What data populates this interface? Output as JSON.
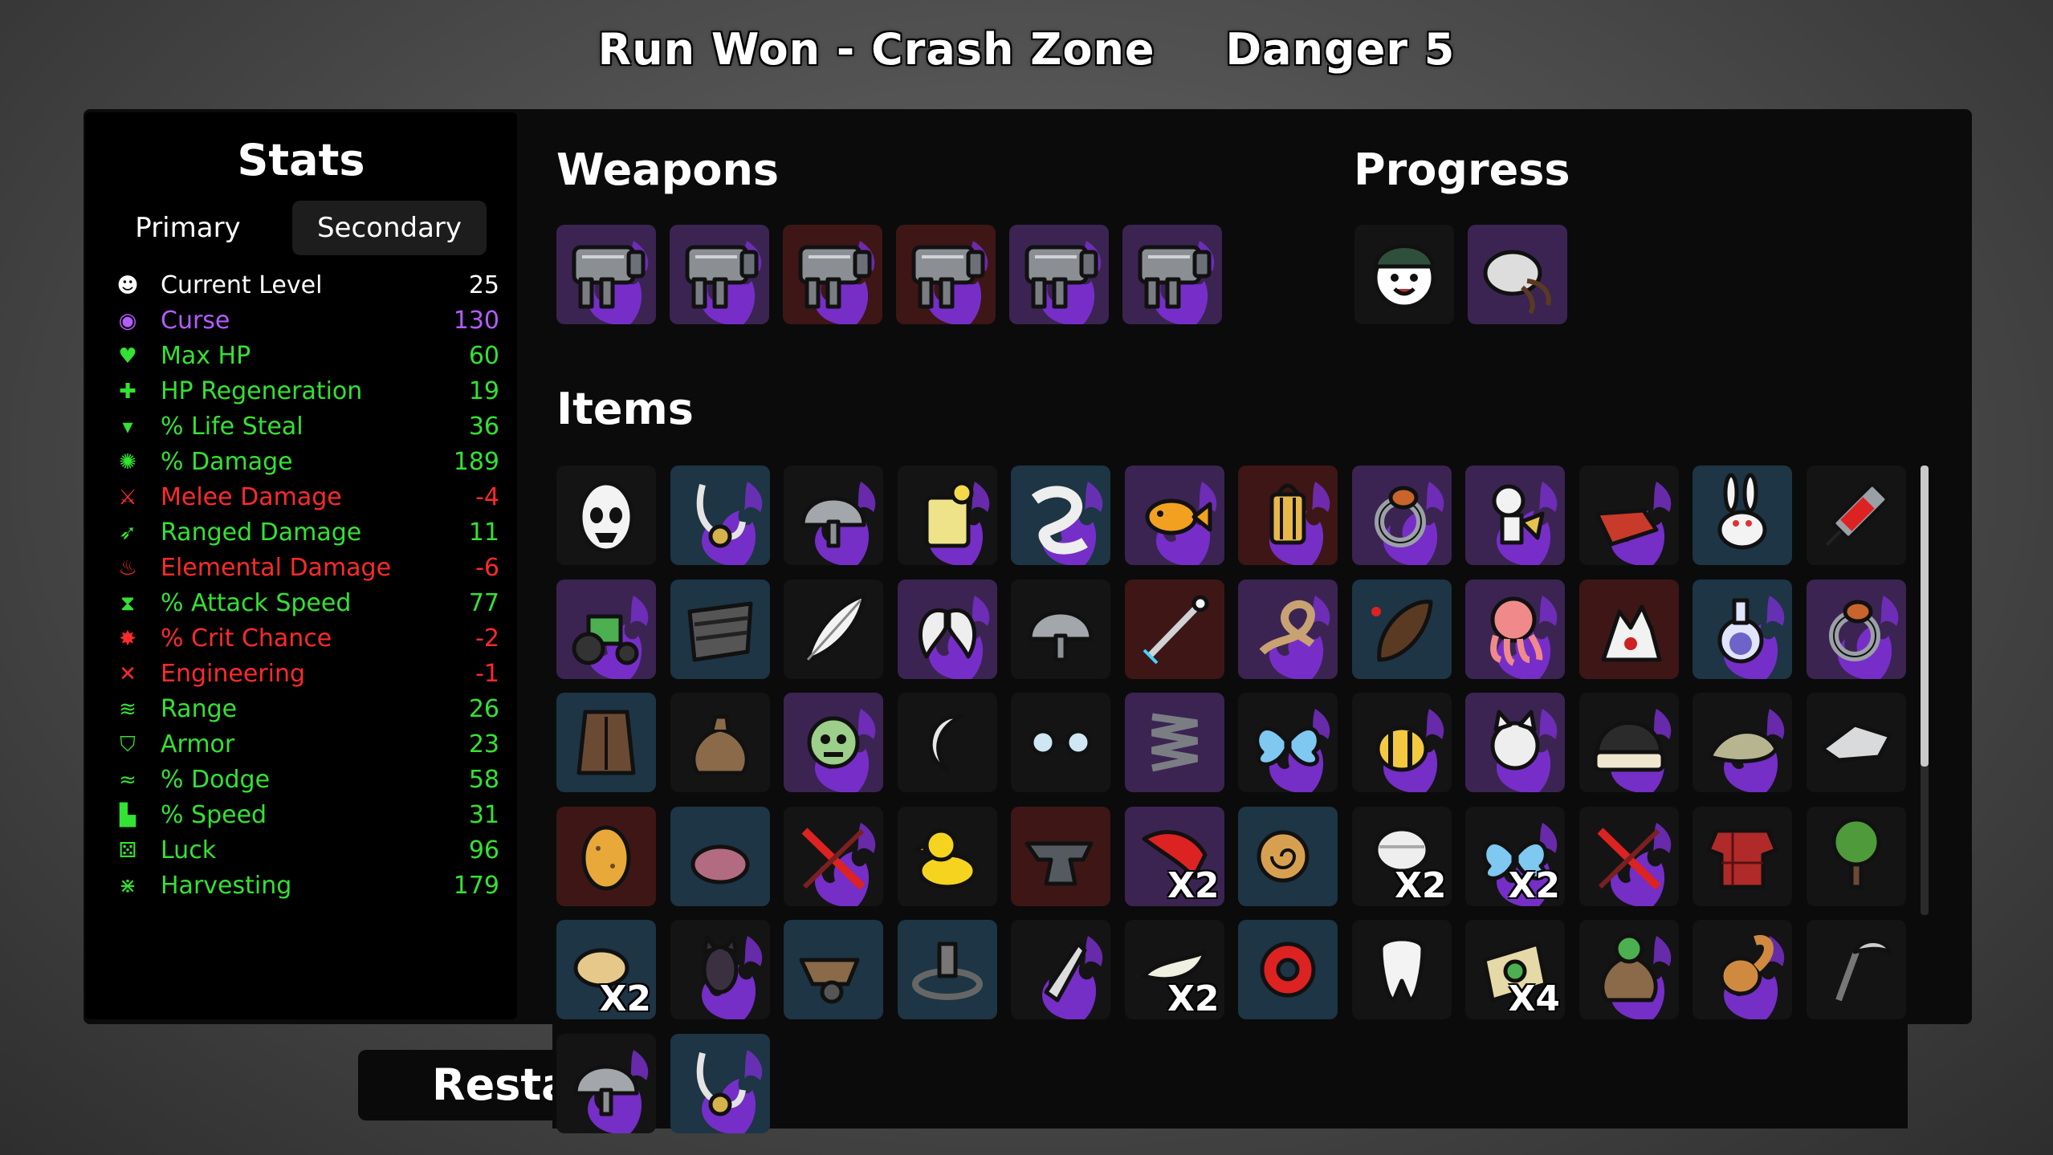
{
  "header": {
    "run": "Run Won - Crash Zone",
    "danger": "Danger 5"
  },
  "stats": {
    "title": "Stats",
    "tabs": {
      "primary": "Primary",
      "secondary": "Secondary"
    },
    "level": {
      "label": "Current Level",
      "value": "25"
    },
    "rows": [
      {
        "label": "Curse",
        "value": "130",
        "color": "#b35cff",
        "icon": "curse-eye-icon"
      },
      {
        "label": "Max HP",
        "value": "60",
        "color": "#33e233",
        "icon": "heart-icon"
      },
      {
        "label": "HP Regeneration",
        "value": "19",
        "color": "#33e233",
        "icon": "regen-heart-icon"
      },
      {
        "label": "% Life Steal",
        "value": "36",
        "color": "#33e233",
        "icon": "fangs-icon"
      },
      {
        "label": "% Damage",
        "value": "189",
        "color": "#33e233",
        "icon": "brain-icon"
      },
      {
        "label": "Melee Damage",
        "value": "-4",
        "color": "#ff2a2a",
        "icon": "sword-icon"
      },
      {
        "label": "Ranged Damage",
        "value": "11",
        "color": "#33e233",
        "icon": "bow-icon"
      },
      {
        "label": "Elemental Damage",
        "value": "-6",
        "color": "#ff2a2a",
        "icon": "flame-icon"
      },
      {
        "label": "% Attack Speed",
        "value": "77",
        "color": "#33e233",
        "icon": "hourglass-icon"
      },
      {
        "label": "% Crit Chance",
        "value": "-2",
        "color": "#ff2a2a",
        "icon": "crit-star-icon"
      },
      {
        "label": "Engineering",
        "value": "-1",
        "color": "#ff2a2a",
        "icon": "wrench-icon"
      },
      {
        "label": "Range",
        "value": "26",
        "color": "#33e233",
        "icon": "range-waves-icon"
      },
      {
        "label": "Armor",
        "value": "23",
        "color": "#33e233",
        "icon": "shield-icon"
      },
      {
        "label": "% Dodge",
        "value": "58",
        "color": "#33e233",
        "icon": "dodge-wind-icon"
      },
      {
        "label": "% Speed",
        "value": "31",
        "color": "#33e233",
        "icon": "boot-icon"
      },
      {
        "label": "Luck",
        "value": "96",
        "color": "#33e233",
        "icon": "dice-icon"
      },
      {
        "label": "Harvesting",
        "value": "179",
        "color": "#33e233",
        "icon": "wheat-icon"
      }
    ]
  },
  "weapons": {
    "title": "Weapons",
    "slots": [
      {
        "tier": "purple",
        "icon": "minigun-icon"
      },
      {
        "tier": "purple",
        "icon": "minigun-icon"
      },
      {
        "tier": "red",
        "icon": "minigun-icon"
      },
      {
        "tier": "red",
        "icon": "minigun-icon"
      },
      {
        "tier": "purple",
        "icon": "minigun-icon"
      },
      {
        "tier": "purple",
        "icon": "minigun-icon"
      }
    ]
  },
  "progress": {
    "title": "Progress",
    "slots": [
      {
        "tier": "dark",
        "icon": "character-face-icon"
      },
      {
        "tier": "purple",
        "icon": "hermit-shell-icon"
      }
    ]
  },
  "items": {
    "title": "Items",
    "grid": [
      [
        {
          "tier": "dark",
          "icon": "alien-egg-icon"
        },
        {
          "tier": "blue",
          "icon": "hook-necklace-icon"
        },
        {
          "tier": "dark",
          "icon": "helmet-icon"
        },
        {
          "tier": "dark",
          "icon": "lemonade-icon"
        },
        {
          "tier": "blue",
          "icon": "worm-icon"
        },
        {
          "tier": "purple",
          "icon": "goldfish-icon"
        },
        {
          "tier": "red",
          "icon": "lantern-icon"
        },
        {
          "tier": "purple",
          "icon": "ring-icon"
        },
        {
          "tier": "purple",
          "icon": "skeleton-icon"
        },
        {
          "tier": "dark",
          "icon": "whistle-icon"
        },
        {
          "tier": "blue",
          "icon": "rabbit-icon"
        },
        {
          "tier": "dark",
          "icon": "syringe-icon"
        }
      ],
      [
        {
          "tier": "purple",
          "icon": "tractor-icon"
        },
        {
          "tier": "blue",
          "icon": "scarf-icon"
        },
        {
          "tier": "dark",
          "icon": "feather-icon"
        },
        {
          "tier": "purple",
          "icon": "wings-icon"
        },
        {
          "tier": "dark",
          "icon": "steel-helmet-icon"
        },
        {
          "tier": "red",
          "icon": "wand-icon"
        },
        {
          "tier": "purple",
          "icon": "rope-icon"
        },
        {
          "tier": "blue",
          "icon": "leech-icon"
        },
        {
          "tier": "purple",
          "icon": "octopus-icon"
        },
        {
          "tier": "red",
          "icon": "claw-icon"
        },
        {
          "tier": "blue",
          "icon": "potion-icon"
        },
        {
          "tier": "purple",
          "icon": "monster-ring-icon"
        }
      ],
      [
        {
          "tier": "blue",
          "icon": "armor-vest-icon"
        },
        {
          "tier": "dark",
          "icon": "bag-icon"
        },
        {
          "tier": "purple",
          "icon": "zombie-icon"
        },
        {
          "tier": "dark",
          "icon": "crescent-icon"
        },
        {
          "tier": "dark",
          "icon": "glasses-icon"
        },
        {
          "tier": "purple",
          "icon": "spring-icon"
        },
        {
          "tier": "dark",
          "icon": "butterfly-icon"
        },
        {
          "tier": "dark",
          "icon": "bee-icon"
        },
        {
          "tier": "purple",
          "icon": "cat-icon"
        },
        {
          "tier": "dark",
          "icon": "beanie-icon"
        },
        {
          "tier": "dark",
          "icon": "slug-icon"
        },
        {
          "tier": "dark",
          "icon": "robot-claw-icon"
        }
      ],
      [
        {
          "tier": "red",
          "icon": "potato-icon"
        },
        {
          "tier": "blue",
          "icon": "mole-icon"
        },
        {
          "tier": "dark",
          "icon": "cross-slash-icon"
        },
        {
          "tier": "dark",
          "icon": "duck-icon"
        },
        {
          "tier": "red",
          "icon": "anvil-icon"
        },
        {
          "tier": "purple",
          "icon": "bandana-icon",
          "count": "X2"
        },
        {
          "tier": "blue",
          "icon": "snail-icon"
        },
        {
          "tier": "dark",
          "icon": "bandaged-fist-icon",
          "count": "X2"
        },
        {
          "tier": "dark",
          "icon": "blue-butterfly-icon",
          "count": "X2"
        },
        {
          "tier": "dark",
          "icon": "cross-slash-icon"
        },
        {
          "tier": "dark",
          "icon": "plaid-shirt-icon"
        },
        {
          "tier": "dark",
          "icon": "tree-icon"
        }
      ],
      [
        {
          "tier": "blue",
          "icon": "cookie-crumbs-icon",
          "count": "X2"
        },
        {
          "tier": "dark",
          "icon": "bat-icon"
        },
        {
          "tier": "blue",
          "icon": "wheelbarrow-icon"
        },
        {
          "tier": "blue",
          "icon": "stone-circle-icon"
        },
        {
          "tier": "dark",
          "icon": "rocket-icon"
        },
        {
          "tier": "dark",
          "icon": "lizard-icon",
          "count": "X2"
        },
        {
          "tier": "blue",
          "icon": "tape-roll-icon"
        },
        {
          "tier": "dark",
          "icon": "tooth-icon"
        },
        {
          "tier": "dark",
          "icon": "alien-map-icon",
          "count": "X4"
        },
        {
          "tier": "dark",
          "icon": "seed-sack-icon"
        },
        {
          "tier": "dark",
          "icon": "squirrel-icon"
        },
        {
          "tier": "dark",
          "icon": "scythe-icon"
        }
      ],
      [
        {
          "tier": "dark",
          "icon": "helmet-icon"
        },
        {
          "tier": "blue",
          "icon": "fishing-hook-icon"
        }
      ]
    ]
  },
  "restart_label": "Restart",
  "colors": {
    "red_tier": "#3e1616",
    "purple_tier": "#3b2452",
    "blue_tier": "#1d3544",
    "dark_tier": "#141414",
    "flame": "#7a2fd0"
  }
}
